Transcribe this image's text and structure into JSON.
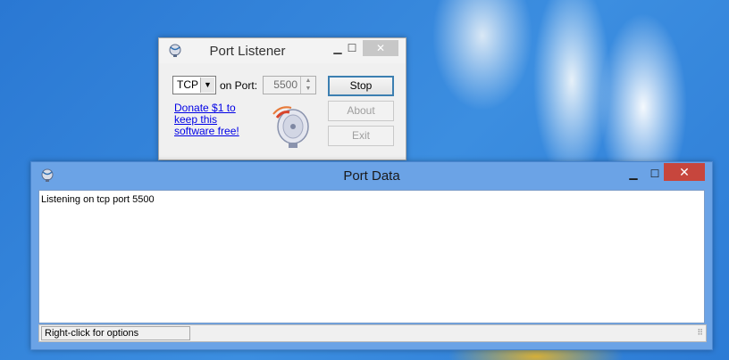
{
  "port_listener": {
    "title": "Port Listener",
    "protocol_selected": "TCP",
    "on_port_label": "on Port:",
    "port_value": "5500",
    "donate_text": "Donate $1 to keep this software free!",
    "stop_label": "Stop",
    "about_label": "About",
    "exit_label": "Exit",
    "min_glyph": "▁",
    "max_glyph": "☐",
    "close_glyph": "✕"
  },
  "port_data": {
    "title": "Port Data",
    "log_text": "Listening on tcp port 5500",
    "status_text": "Right-click for options",
    "min_glyph": "▁",
    "max_glyph": "☐",
    "close_glyph": "✕"
  },
  "icons": {
    "app_icon": "satellite-dish-icon",
    "dish_image": "satellite-dish-icon"
  },
  "colors": {
    "close_active": "#c7463d",
    "titlebar_active": "#6ba3e6",
    "link": "#0000e6",
    "button_focus": "#3c7fb1"
  }
}
